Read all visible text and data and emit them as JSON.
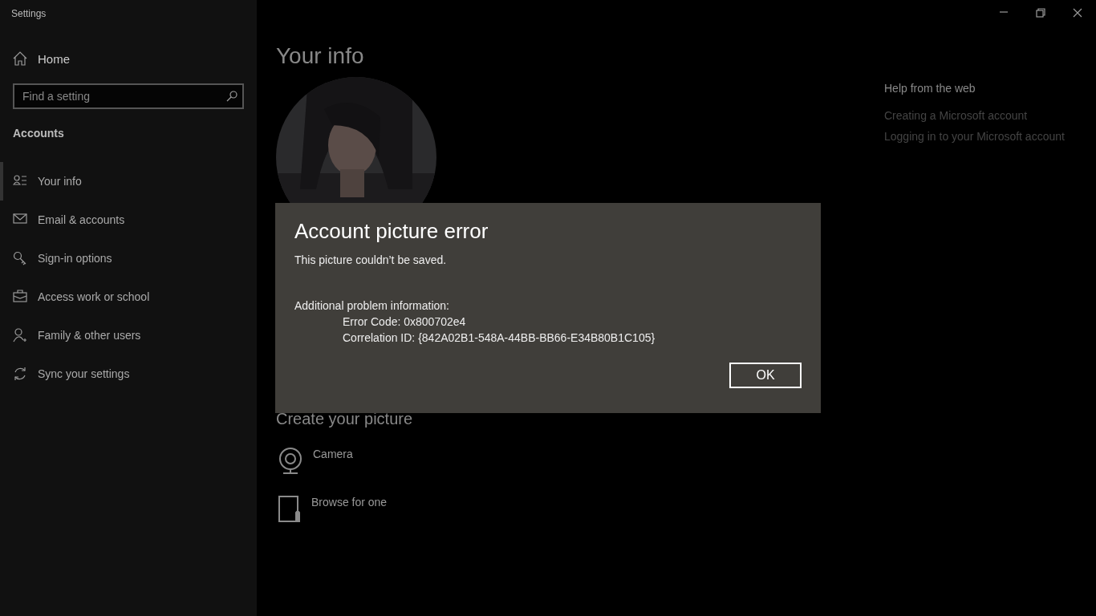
{
  "window": {
    "title": "Settings"
  },
  "sidebar": {
    "home": {
      "label": "Home"
    },
    "search": {
      "placeholder": "Find a setting"
    },
    "section": "Accounts",
    "items": [
      {
        "label": "Your info",
        "kind": "info",
        "selected": true
      },
      {
        "label": "Email & accounts",
        "kind": "mail",
        "selected": false
      },
      {
        "label": "Sign-in options",
        "kind": "key",
        "selected": false
      },
      {
        "label": "Access work or school",
        "kind": "briefcase",
        "selected": false
      },
      {
        "label": "Family & other users",
        "kind": "adduser",
        "selected": false
      },
      {
        "label": "Sync your settings",
        "kind": "sync",
        "selected": false
      }
    ]
  },
  "main": {
    "title": "Your info",
    "create_heading": "Create your picture",
    "options": [
      {
        "label": "Camera",
        "kind": "camera"
      },
      {
        "label": "Browse for one",
        "kind": "browse"
      }
    ]
  },
  "help": {
    "heading": "Help from the web",
    "links": [
      "Creating a Microsoft account",
      "Logging in to your Microsoft account"
    ]
  },
  "dialog": {
    "title": "Account picture error",
    "message": "This picture couldn’t be saved.",
    "info_heading": "Additional problem information:",
    "details": [
      "Error Code: 0x800702e4",
      "Correlation ID: {842A02B1-548A-44BB-BB66-E34B80B1C105}"
    ],
    "button": "OK"
  }
}
